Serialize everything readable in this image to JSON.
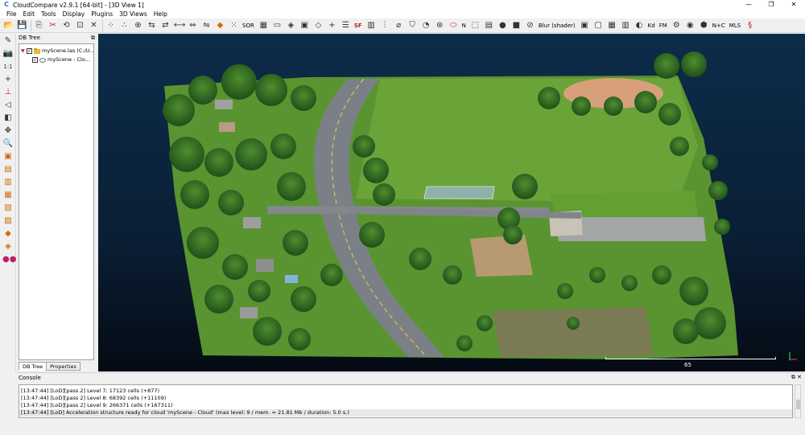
{
  "window": {
    "title": "CloudCompare v2.9.1 [64-bit] - [3D View 1]",
    "controls": [
      "—",
      "❐",
      "✕"
    ]
  },
  "menu": [
    "File",
    "Edit",
    "Tools",
    "Display",
    "Plugins",
    "3D Views",
    "Help"
  ],
  "toolbar": {
    "sor_label": "SOR",
    "sf_label": "SF",
    "n_label": "N",
    "shader_label": "Blur (shader)",
    "kd_label": "Kd",
    "fm_label": "FM",
    "nc_label": "N+C",
    "mls_label": "MLS"
  },
  "db_tree": {
    "title": "DB Tree",
    "items": [
      {
        "label": "myScene.las (C:/U..."
      },
      {
        "label": "myScene - Clo..."
      }
    ],
    "tabs": [
      "DB Tree",
      "Properties"
    ]
  },
  "view": {
    "scale_label": "65"
  },
  "console": {
    "title": "Console",
    "lines": [
      "[13:47:44] [LoD][pass 2] Level 7: 17123 cells (+877)",
      "[13:47:44] [LoD][pass 2] Level 8: 68392 cells (+11109)",
      "[13:47:44] [LoD][pass 2] Level 9: 266371 cells (+167311)",
      "[13:47:44] [LoD] Acceleration structure ready for cloud 'myScene - Cloud' (max level: 9 / mem. = 21.81 Mb / duration: 5.0 s.)"
    ]
  },
  "colors": {
    "grass": "#5f9a2e",
    "trees": "#2f6a22",
    "road": "#7a7f85",
    "background": "#0b2540"
  }
}
